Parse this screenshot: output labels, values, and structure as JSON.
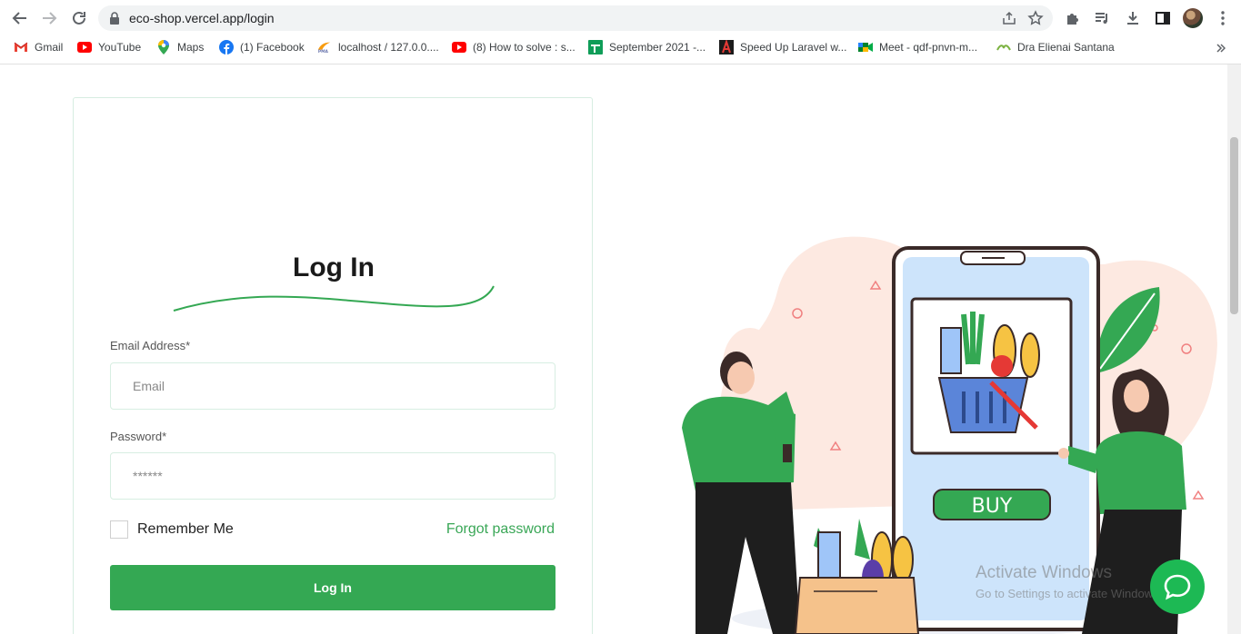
{
  "browser": {
    "url": "eco-shop.vercel.app/login",
    "bookmarks": [
      {
        "label": "Gmail",
        "icon": "gmail-icon"
      },
      {
        "label": "YouTube",
        "icon": "youtube-icon"
      },
      {
        "label": "Maps",
        "icon": "maps-icon"
      },
      {
        "label": "(1) Facebook",
        "icon": "facebook-icon"
      },
      {
        "label": "localhost / 127.0.0....",
        "icon": "phpmyadmin-icon"
      },
      {
        "label": "(8) How to solve : s...",
        "icon": "youtube-icon"
      },
      {
        "label": "September 2021 -...",
        "icon": "sheets-icon"
      },
      {
        "label": "Speed Up Laravel w...",
        "icon": "laravel-icon"
      },
      {
        "label": "Meet - qdf-pnvn-m...",
        "icon": "meet-icon"
      },
      {
        "label": "Dra Elienai Santana",
        "icon": "site-icon"
      }
    ]
  },
  "login": {
    "title": "Log In",
    "email_label": "Email Address*",
    "email_placeholder": "Email",
    "password_label": "Password*",
    "password_placeholder": "******",
    "remember_label": "Remember Me",
    "forgot_label": "Forgot password",
    "submit_label": "Log In"
  },
  "illustration": {
    "buy_label": "BUY"
  },
  "watermark": {
    "line1": "Activate Windows",
    "line2": "Go to Settings to activate Windows."
  },
  "colors": {
    "accent": "#34a853",
    "forgot": "#3aa757"
  }
}
